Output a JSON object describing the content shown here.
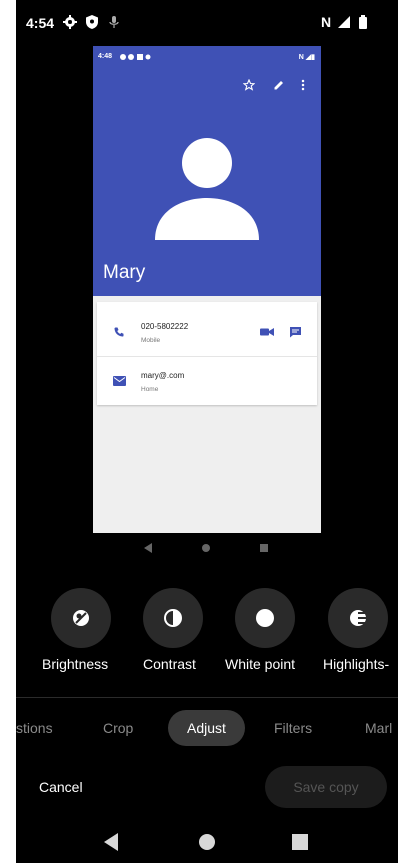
{
  "status_bar": {
    "time": "4:54",
    "network": "N"
  },
  "preview": {
    "status_time": "4:48",
    "status_network": "N",
    "contact_name": "Mary",
    "rows": [
      {
        "primary": "020-5802222",
        "secondary": "Mobile",
        "icon": "phone-icon"
      },
      {
        "primary": "mary@.com",
        "secondary": "Home",
        "icon": "email-icon"
      }
    ]
  },
  "adjust_tools": [
    {
      "label": "Brightness",
      "icon": "brightness-icon"
    },
    {
      "label": "Contrast",
      "icon": "contrast-icon"
    },
    {
      "label": "White point",
      "icon": "white-point-icon"
    },
    {
      "label": "Highlights-",
      "icon": "highlights-icon"
    }
  ],
  "tabs": {
    "suggestions": "stions",
    "crop": "Crop",
    "adjust": "Adjust",
    "filters": "Filters",
    "markup": "Marl"
  },
  "bottom": {
    "cancel": "Cancel",
    "save": "Save copy"
  },
  "colors": {
    "header_blue": "#3f51b5",
    "background": "#000000"
  }
}
